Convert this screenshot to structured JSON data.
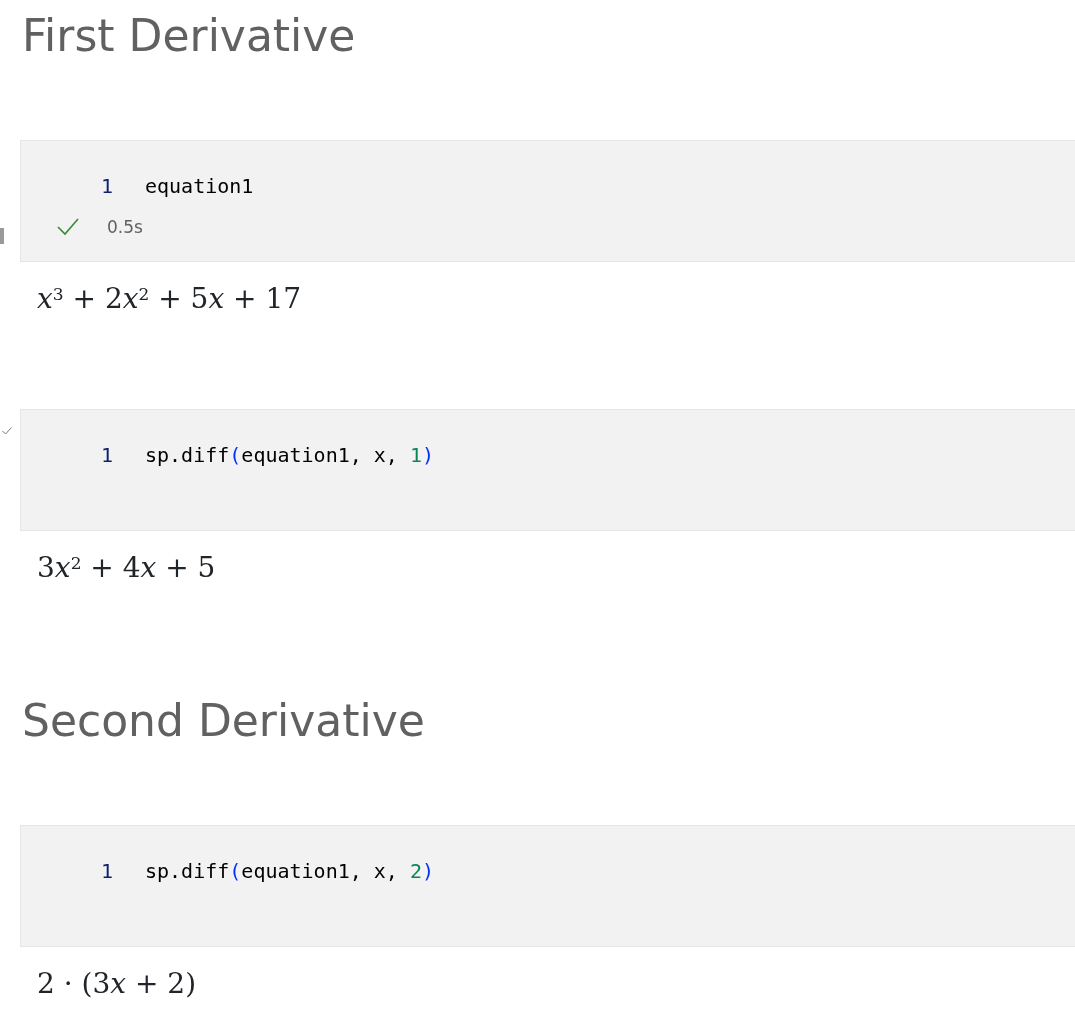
{
  "cells": [
    {
      "kind": "heading",
      "text": "First Derivative"
    },
    {
      "kind": "code",
      "gutter": {
        "kind": "bar"
      },
      "line_number": "1",
      "tokens": [
        {
          "kind": "plain",
          "text": "equation1"
        }
      ],
      "status": {
        "succeeded": true,
        "time": "0.5s"
      },
      "output": [
        {
          "kind": "var",
          "text": "x"
        },
        {
          "kind": "sup",
          "text": "3"
        },
        {
          "kind": "text",
          "text": " + 2"
        },
        {
          "kind": "var",
          "text": "x"
        },
        {
          "kind": "sup",
          "text": "2"
        },
        {
          "kind": "text",
          "text": " + 5"
        },
        {
          "kind": "var",
          "text": "x"
        },
        {
          "kind": "text",
          "text": " + 17"
        }
      ]
    },
    {
      "kind": "code",
      "gutter": {
        "kind": "check"
      },
      "line_number": "1",
      "tokens": [
        {
          "kind": "plain",
          "text": "sp.diff"
        },
        {
          "kind": "paren",
          "text": "("
        },
        {
          "kind": "plain",
          "text": "equation1, x, "
        },
        {
          "kind": "number",
          "text": "1"
        },
        {
          "kind": "paren",
          "text": ")"
        }
      ],
      "output": [
        {
          "kind": "text",
          "text": "3"
        },
        {
          "kind": "var",
          "text": "x"
        },
        {
          "kind": "sup",
          "text": "2"
        },
        {
          "kind": "text",
          "text": " + 4"
        },
        {
          "kind": "var",
          "text": "x"
        },
        {
          "kind": "text",
          "text": " + 5"
        }
      ]
    },
    {
      "kind": "heading",
      "text": "Second Derivative"
    },
    {
      "kind": "code",
      "line_number": "1",
      "tokens": [
        {
          "kind": "plain",
          "text": "sp.diff"
        },
        {
          "kind": "paren",
          "text": "("
        },
        {
          "kind": "plain",
          "text": "equation1, x, "
        },
        {
          "kind": "number",
          "text": "2"
        },
        {
          "kind": "paren",
          "text": ")"
        }
      ],
      "output": [
        {
          "kind": "text",
          "text": "2 · (3"
        },
        {
          "kind": "var",
          "text": "x"
        },
        {
          "kind": "text",
          "text": " + 2)"
        }
      ]
    }
  ]
}
